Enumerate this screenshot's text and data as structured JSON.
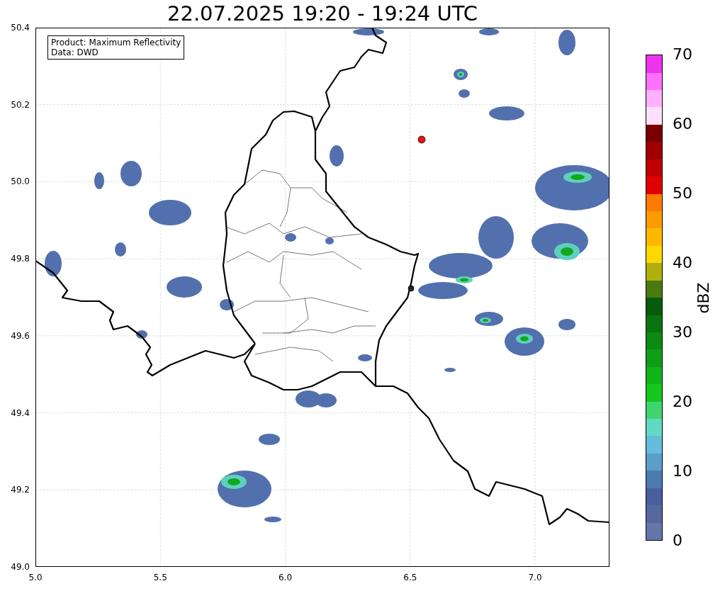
{
  "title": "22.07.2025 19:20 - 19:24 UTC",
  "info_box": [
    "Product: Maximum Reflectivity",
    "Data: DWD"
  ],
  "x_ticks": [
    "5.0",
    "5.5",
    "6.0",
    "6.5",
    "7.0"
  ],
  "y_ticks": [
    "50.4",
    "50.2",
    "50.0",
    "49.8",
    "49.6",
    "49.4",
    "49.2",
    "49.0"
  ],
  "colorbar": {
    "label": "dBZ",
    "ticks": [
      "70",
      "60",
      "50",
      "40",
      "30",
      "20",
      "10",
      "0"
    ],
    "bins": [
      {
        "color": "#6577a8"
      },
      {
        "color": "#5668a0"
      },
      {
        "color": "#4a5f9f"
      },
      {
        "color": "#4d7ab0"
      },
      {
        "color": "#5b9ec8"
      },
      {
        "color": "#63bddb"
      },
      {
        "color": "#62d9c4"
      },
      {
        "color": "#3fd46f"
      },
      {
        "color": "#14c81e"
      },
      {
        "color": "#10b419"
      },
      {
        "color": "#0f9f17"
      },
      {
        "color": "#0c8a12"
      },
      {
        "color": "#0a7510"
      },
      {
        "color": "#075b0c"
      },
      {
        "color": "#4a7a0f"
      },
      {
        "color": "#afb00c"
      },
      {
        "color": "#ffd800"
      },
      {
        "color": "#ffb800"
      },
      {
        "color": "#ff9a00"
      },
      {
        "color": "#ff7a00"
      },
      {
        "color": "#e00000"
      },
      {
        "color": "#c00000"
      },
      {
        "color": "#a00000"
      },
      {
        "color": "#780000"
      },
      {
        "color": "#ffe0ff"
      },
      {
        "color": "#ffb0ff"
      },
      {
        "color": "#ff70ff"
      },
      {
        "color": "#ee33ee"
      }
    ]
  }
}
